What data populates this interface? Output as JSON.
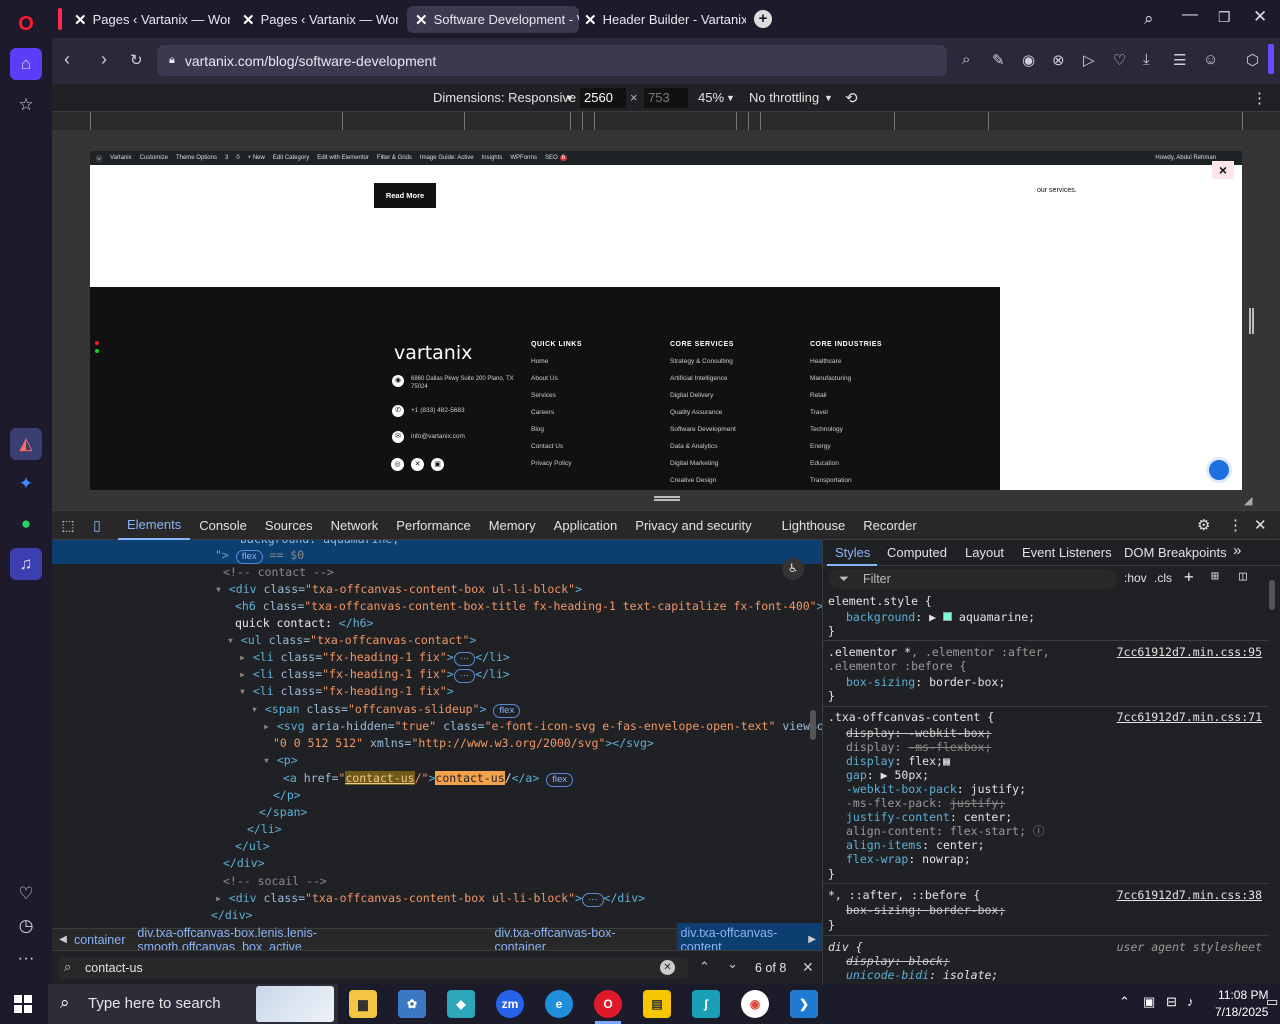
{
  "tabs": [
    {
      "label": "Pages ‹ Vartanix — WordP",
      "active": false
    },
    {
      "label": "Pages ‹ Vartanix — WordP",
      "active": false
    },
    {
      "label": "Software Development - V",
      "active": true
    },
    {
      "label": "Header Builder - Vartanix",
      "active": false
    }
  ],
  "url": "vartanix.com/blog/software-development",
  "devtoolbar": {
    "dimensions": "Dimensions: Responsive",
    "width": "2560",
    "height": "753",
    "zoom": "45%",
    "throttle": "No throttling",
    "times": "×"
  },
  "wpbar": {
    "items": [
      "Vartanix",
      "Customize",
      "Theme Options",
      "3",
      "0",
      "+ New",
      "Edit Category",
      "Edit with Elementor",
      "Filter & Grids",
      "Image Guide: Active",
      "Insights",
      "WPForms",
      "SEO",
      "6"
    ],
    "howdy": "Howdy, Abdul Rehman"
  },
  "page": {
    "read_more": "Read More",
    "our_services": "our services.",
    "close": "×",
    "logo": "vartanix",
    "address": "6860 Dallas Pkwy Suite 200 Plano, TX 75024",
    "phone": "+1 (833) 482-5683",
    "email": "info@vartanix.com",
    "quick_links_title": "QUICK LINKS",
    "quick_links": [
      "Home",
      "About Us",
      "Services",
      "Careers",
      "Blog",
      "Contact Us",
      "Privacy Policy"
    ],
    "core_services_title": "CORE SERVICES",
    "core_services": [
      "Strategy & Consulting",
      "Artificial Intelligence",
      "Digital Delivery",
      "Quality Assurance",
      "Software Development",
      "Data & Analytics",
      "Digital Marketing",
      "Creative Design"
    ],
    "core_industries_title": "CORE INDUSTRIES",
    "core_industries": [
      "Healthcare",
      "Manufacturing",
      "Retail",
      "Travel",
      "Technology",
      "Energy",
      "Education",
      "Transportation"
    ]
  },
  "devtabs": [
    "Elements",
    "Console",
    "Sources",
    "Network",
    "Performance",
    "Memory",
    "Application",
    "Privacy and security",
    "Lighthouse",
    "Recorder"
  ],
  "code": {
    "l0": "background: aquamarine;",
    "l1a": "\">",
    "l1pill": "flex",
    "l1b": "== $0",
    "l2": "<!-- contact -->",
    "l3tag": "<div ",
    "l3attr": "class=",
    "l3val": "\"txa-offcanvas-content-box  ul-li-block\"",
    "l3end": ">",
    "l4tag": "<h6 ",
    "l4attr": "class=",
    "l4val": "\"txa-offcanvas-content-box-title fx-heading-1 text-capitalize fx-font-400\"",
    "l4end": ">",
    "l5text": "quick contact: ",
    "l5end": "</h6>",
    "l6tag": "<ul ",
    "l6attr": "class=",
    "l6val": "\"txa-offcanvas-contact\"",
    "l6end": ">",
    "li_tag": "<li ",
    "li_attr": "class=",
    "li_val": "\"fx-heading-1 fix\"",
    "li_end": ">",
    "li_close": "</li>",
    "ellipsis": "···",
    "l10tag": "<span ",
    "l10attr": "class=",
    "l10val": "\"offcanvas-slideup\"",
    "l10end": ">",
    "l10pill": "flex",
    "l11tag": "<svg ",
    "l11a1": "aria-hidden=",
    "l11v1": "\"true\"",
    "l11a2": " class=",
    "l11v2": "\"e-font-icon-svg e-fas-envelope-open-text\"",
    "l11a3": " viewBox=",
    "l12v": "\"0 0 512 512\"",
    "l12a": " xmlns=",
    "l12v2": "\"http://www.w3.org/2000/svg\"",
    "l12end": "></svg>",
    "l13": "<p>",
    "l14tag": "<a ",
    "l14attr": "href=",
    "l14q": "\"",
    "l14hl": "contact-us",
    "l14rest": "/\"",
    "l14gt": ">",
    "l14hl2": "contact-us",
    "l14text": "/",
    "l14close": "</a>",
    "l14pill": "flex",
    "l15": "</p>",
    "l16": "</span>",
    "l17": "</li>",
    "l18": "</ul>",
    "l19": "</div>",
    "l20": "<!-- socail -->",
    "l21tag": "<div ",
    "l21attr": "class=",
    "l21val": "\"txa-offcanvas-content-box ul-li-block\"",
    "l21end": ">",
    "l21close": "</div>",
    "l22": "</div>"
  },
  "crumbs": [
    "container",
    "div.txa-offcanvas-box.lenis.lenis-smooth.offcanvas_box_active",
    "div.txa-offcanvas-box-container",
    "div.txa-offcanvas-content"
  ],
  "search": {
    "value": "contact-us",
    "count": "6 of 8"
  },
  "styles": {
    "tabs": [
      "Styles",
      "Computed",
      "Layout",
      "Event Listeners",
      "DOM Breakpoints"
    ],
    "filter_placeholder": "Filter",
    "hov": ":hov",
    "cls": ".cls",
    "r1sel": "element.style {",
    "r1p": "background",
    "r1v": "aquamarine;",
    "r2sel": ".elementor *, .elementor :after,",
    "r2sel2": ".elementor :before {",
    "r2src": "7cc61912d7.min.css:95",
    "r2p": "box-sizing",
    "r2v": "border-box;",
    "r3sel": ".txa-offcanvas-content {",
    "r3src": "7cc61912d7.min.css:71",
    "r3props": [
      {
        "p": "display",
        "v": "-webkit-box;",
        "s": true
      },
      {
        "p": "display",
        "v": "-ms-flexbox;",
        "s": true
      },
      {
        "p": "display",
        "v": "flex;",
        "s": false
      },
      {
        "p": "gap",
        "v": "▶ 50px;",
        "s": false
      },
      {
        "p": "-webkit-box-pack",
        "v": "justify;",
        "s": false
      },
      {
        "p": "-ms-flex-pack",
        "v": "justify;",
        "s": true
      },
      {
        "p": "justify-content",
        "v": "center;",
        "s": false
      },
      {
        "p": "align-content",
        "v": "flex-start;",
        "s": false
      },
      {
        "p": "align-items",
        "v": "center;",
        "s": false
      },
      {
        "p": "flex-wrap",
        "v": "nowrap;",
        "s": false
      }
    ],
    "r4sel": "*, ::after, ::before {",
    "r4src": "7cc61912d7.min.css:38",
    "r4p": "box-sizing",
    "r4v": "border-box;",
    "r5sel": "div {",
    "r5src": "user agent stylesheet",
    "r5p1": "display",
    "r5v1": "block;",
    "r5p2": "unicode-bidi",
    "r5v2": "isolate;",
    "close_brace": "}"
  },
  "taskbar": {
    "search_placeholder": "Type here to search",
    "time": "11:08 PM",
    "date": "7/18/2025"
  }
}
